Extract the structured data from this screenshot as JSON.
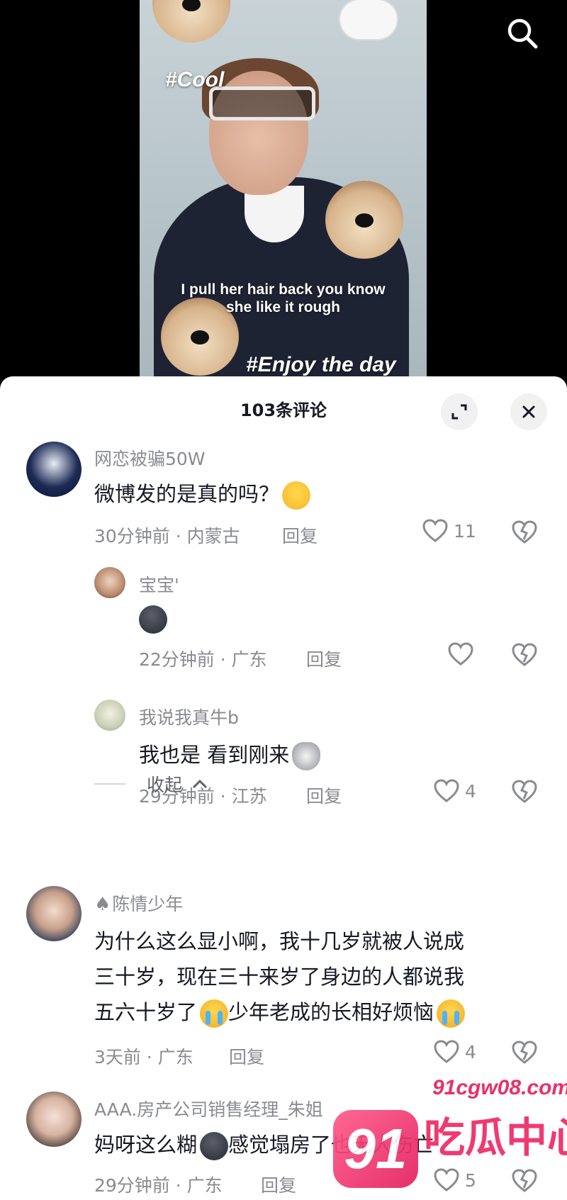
{
  "video": {
    "tag_cool": "#Cool",
    "lyric": "I pull her hair back you know she like it rough",
    "tag_enjoy": "#Enjoy the day"
  },
  "sheet": {
    "title": "103条评论"
  },
  "comments": [
    {
      "username": "网恋被骗50W",
      "text": "微博发的是真的吗？",
      "emoji": "laughing-crying-emoji",
      "meta": "30分钟前 · 内蒙古",
      "reply": "回复",
      "likes": "11"
    },
    {
      "username": "宝宝'",
      "text": "",
      "emoji": "dark-face-emoji",
      "meta": "22分钟前 · 广东",
      "reply": "回复",
      "likes": ""
    },
    {
      "username": "我说我真牛b",
      "text": "我也是 看到刚来",
      "emoji": "husky-dog-emoji",
      "meta": "29分钟前 · 江苏",
      "reply": "回复",
      "likes": "4"
    },
    {
      "username": "陈情少年",
      "line1": "为什么这么显小啊，我十几岁就被人说成",
      "line2": "三十岁，现在三十来岁了身边的人都说我",
      "line3a": "五六十岁了",
      "line3b": "少年老成的长相好烦恼",
      "meta": "3天前 · 广东",
      "reply": "回复",
      "likes": "4"
    },
    {
      "username": "AAA.房产公司销售经理_朱姐",
      "text_a": "妈呀这么糊",
      "text_b": "感觉塌房了也无人伤亡",
      "meta": "29分钟前 · 广东",
      "reply": "回复",
      "likes": "5"
    }
  ],
  "collapse": {
    "label": "收起"
  },
  "watermark": {
    "site": "91cgw08.com",
    "logo": "91",
    "text": "吃瓜中心"
  },
  "colors": {
    "meta_gray": "#8a8b91",
    "text": "#161823",
    "accent": "#e8306a"
  }
}
